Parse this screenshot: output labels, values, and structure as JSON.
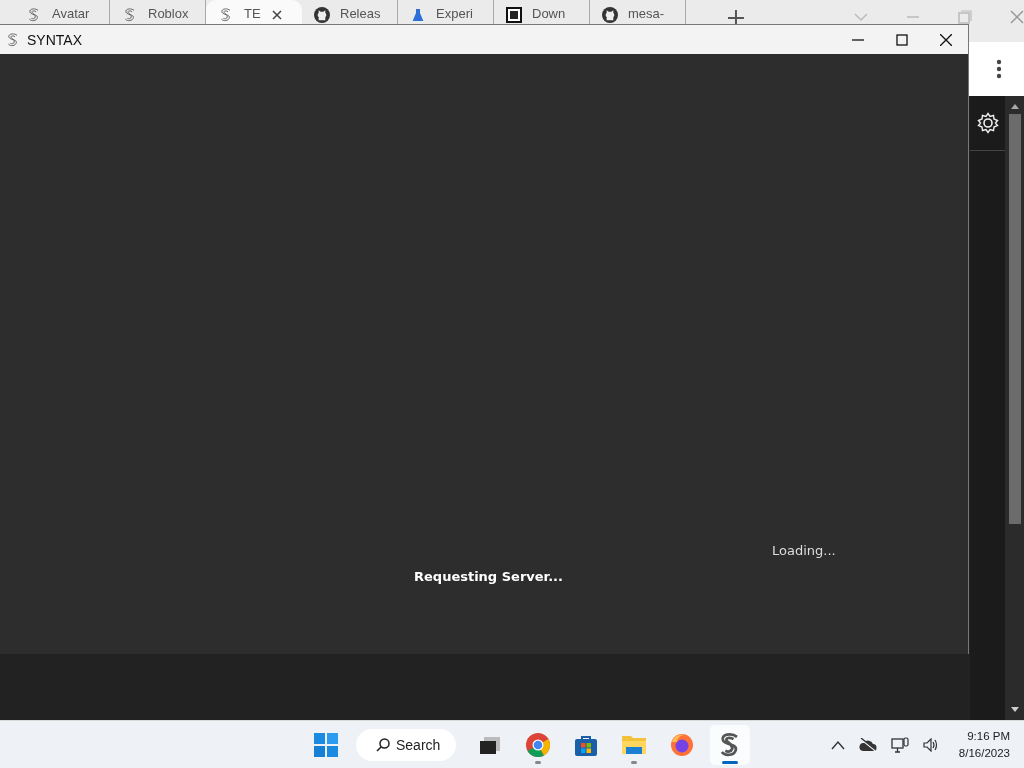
{
  "browser": {
    "tabs": [
      {
        "label": "Avatar",
        "kind": "s-logo",
        "selected": false
      },
      {
        "label": "Roblox",
        "kind": "s-logo",
        "selected": false
      },
      {
        "label": "TE",
        "kind": "s-logo",
        "selected": true
      },
      {
        "label": "Releas",
        "kind": "cat",
        "selected": false
      },
      {
        "label": "Experi",
        "kind": "flask",
        "selected": false
      },
      {
        "label": "Down",
        "kind": "archive",
        "selected": false
      },
      {
        "label": "mesa-",
        "kind": "cat",
        "selected": false
      }
    ]
  },
  "syntax_window": {
    "title": "SYNTAX",
    "status": "Loading...",
    "message": "Requesting Server..."
  },
  "taskbar": {
    "search": "Search",
    "apps": [
      {
        "kind": "windows",
        "running": false,
        "selected": false
      },
      {
        "kind": "wheel",
        "running": true,
        "selected": false
      },
      {
        "kind": "store",
        "running": false,
        "selected": false
      },
      {
        "kind": "folder",
        "running": true,
        "selected": false
      },
      {
        "kind": "fox",
        "running": false,
        "selected": false
      },
      {
        "kind": "s-logo",
        "running": true,
        "selected": true
      }
    ],
    "time": "9:16 PM",
    "date": "8/16/2023"
  }
}
